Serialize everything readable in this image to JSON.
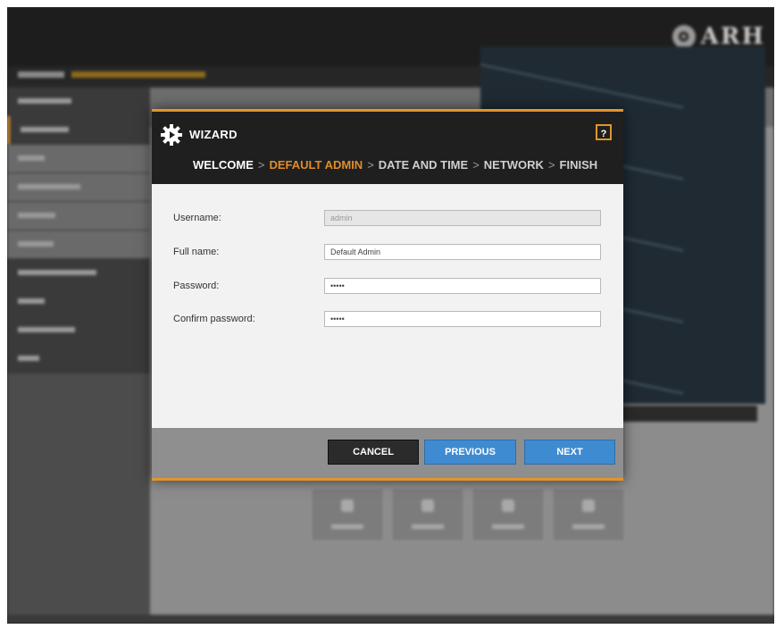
{
  "app": {
    "brand": "ARH",
    "brand_mark": "✪"
  },
  "colors": {
    "accent": "#e0962a",
    "primary_button": "#3f8bd1",
    "dark_header": "#1f1f1f"
  },
  "wizard": {
    "title": "WIZARD",
    "icon": "gear-icon",
    "help_label": "?",
    "steps": [
      {
        "label": "WELCOME",
        "state": "done"
      },
      {
        "label": "DEFAULT ADMIN",
        "state": "current"
      },
      {
        "label": "DATE AND TIME",
        "state": "upcoming"
      },
      {
        "label": "NETWORK",
        "state": "upcoming"
      },
      {
        "label": "FINISH",
        "state": "upcoming"
      }
    ],
    "step_separator": ">",
    "fields": {
      "username": {
        "label": "Username:",
        "value": "admin",
        "disabled": true
      },
      "full_name": {
        "label": "Full name:",
        "value": "Default Admin"
      },
      "password": {
        "label": "Password:",
        "value": "•••••"
      },
      "confirm_password": {
        "label": "Confirm password:",
        "value": "•••••"
      }
    },
    "buttons": {
      "cancel": "CANCEL",
      "previous": "PREVIOUS",
      "next": "NEXT"
    }
  }
}
